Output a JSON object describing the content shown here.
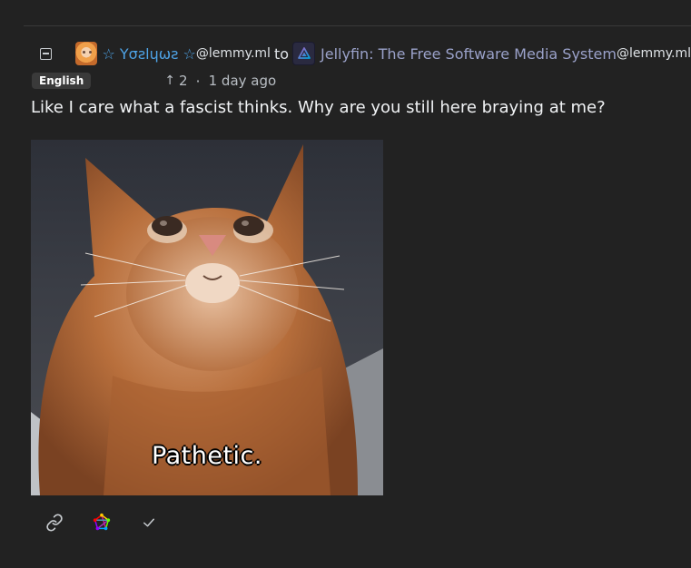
{
  "comment": {
    "username": "☆ Yσƨlɥωƨ ☆",
    "user_instance": "@lemmy.ml",
    "to_word": "to",
    "community_name": "Jellyfin: The Free Software Media System",
    "community_instance": "@lemmy.ml",
    "language": "English",
    "score": "2",
    "separator": "·",
    "time_ago": "1 day ago",
    "text": "Like I care what a fascist thinks. Why are you still here braying at me?",
    "image_caption": "Pathetic."
  },
  "icons": {
    "collapse": "collapse-minus-icon",
    "upvote": "arrow-up-icon",
    "link": "link-icon",
    "fediverse": "fediverse-icon",
    "check": "check-icon"
  },
  "colors": {
    "background": "#222222",
    "username": "#4ea3e6",
    "community": "#9aa1c9",
    "text": "#f1f3f5",
    "badge_bg": "#3a3a3a"
  }
}
